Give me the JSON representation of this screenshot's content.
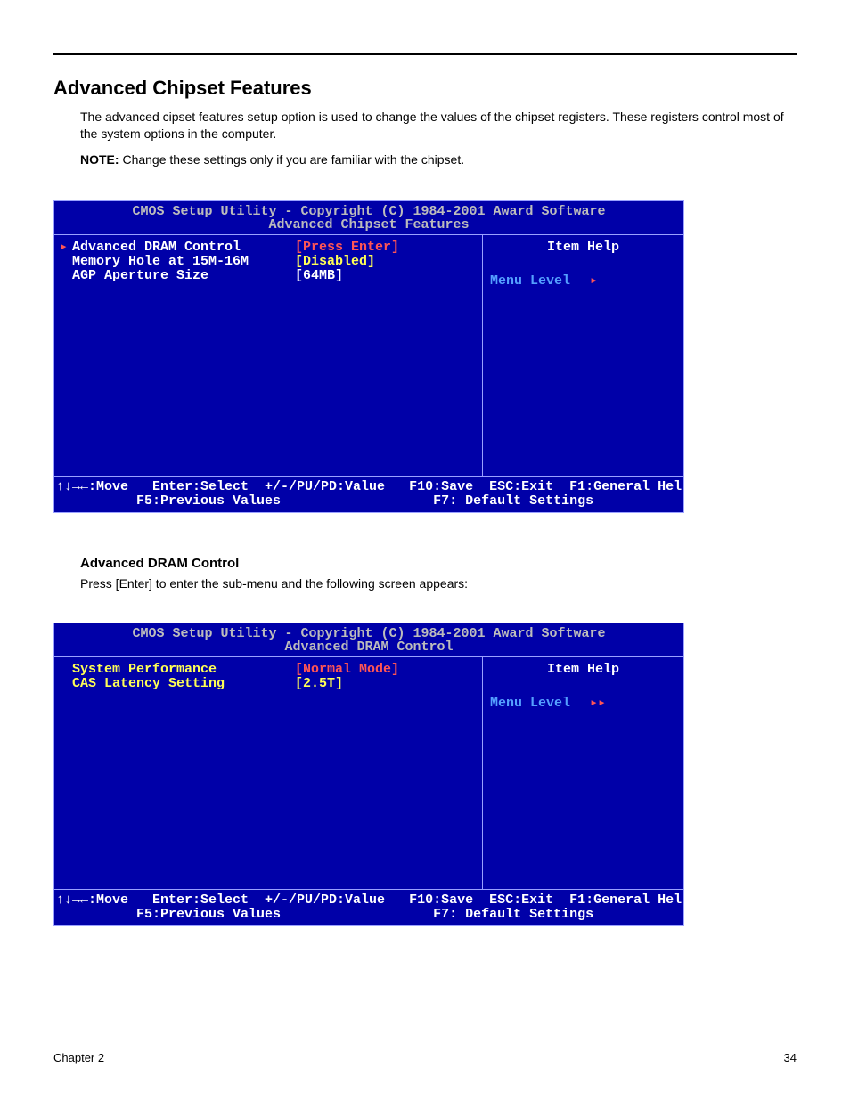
{
  "page": {
    "title": "Advanced Chipset Features",
    "intro1": "The advanced cipset features setup option is used to change the values of the chipset registers.  These registers control most of the system options in the computer.",
    "note_label": "NOTE:",
    "note_text": " Change these settings only if you are familiar with the chipset.",
    "chapter": "Chapter 2",
    "pagenum": "34"
  },
  "bios1": {
    "title_line1": "CMOS Setup Utility - Copyright (C) 1984-2001 Award Software",
    "title_line2": "Advanced Chipset Features",
    "options": [
      {
        "caret": true,
        "name": "Advanced DRAM Control",
        "value": "[Press Enter]",
        "value_style": "selected"
      },
      {
        "caret": false,
        "name": "Memory Hole at 15M-16M",
        "value": "[Disabled]",
        "value_style": "yellow"
      },
      {
        "caret": false,
        "name": "AGP Aperture Size",
        "value": "[64MB]",
        "value_style": "normal"
      }
    ],
    "item_help": "Item Help",
    "menu_level": "Menu Level",
    "menu_caret": "▸",
    "footer_line1": "↑↓→←:Move   Enter:Select  +/-/PU/PD:Value   F10:Save  ESC:Exit  F1:General Hel",
    "footer_line2": "          F5:Previous Values                   F7: Default Settings"
  },
  "sub": {
    "title": "Advanced DRAM Control",
    "desc": "Press [Enter] to enter the sub-menu and the following screen appears:"
  },
  "bios2": {
    "title_line1": "CMOS Setup Utility - Copyright (C) 1984-2001 Award Software",
    "title_line2": "Advanced DRAM Control",
    "options": [
      {
        "caret": false,
        "name": "System Performance",
        "name_style": "yellow",
        "value": "[Normal Mode]",
        "value_style": "selected"
      },
      {
        "caret": false,
        "name": "CAS Latency Setting",
        "name_style": "yellow",
        "value": "[2.5T]",
        "value_style": "yellow"
      }
    ],
    "item_help": "Item Help",
    "menu_level": "Menu Level",
    "menu_caret": "▸▸",
    "footer_line1": "↑↓→←:Move   Enter:Select  +/-/PU/PD:Value   F10:Save  ESC:Exit  F1:General Hel",
    "footer_line2": "          F5:Previous Values                   F7: Default Settings"
  }
}
